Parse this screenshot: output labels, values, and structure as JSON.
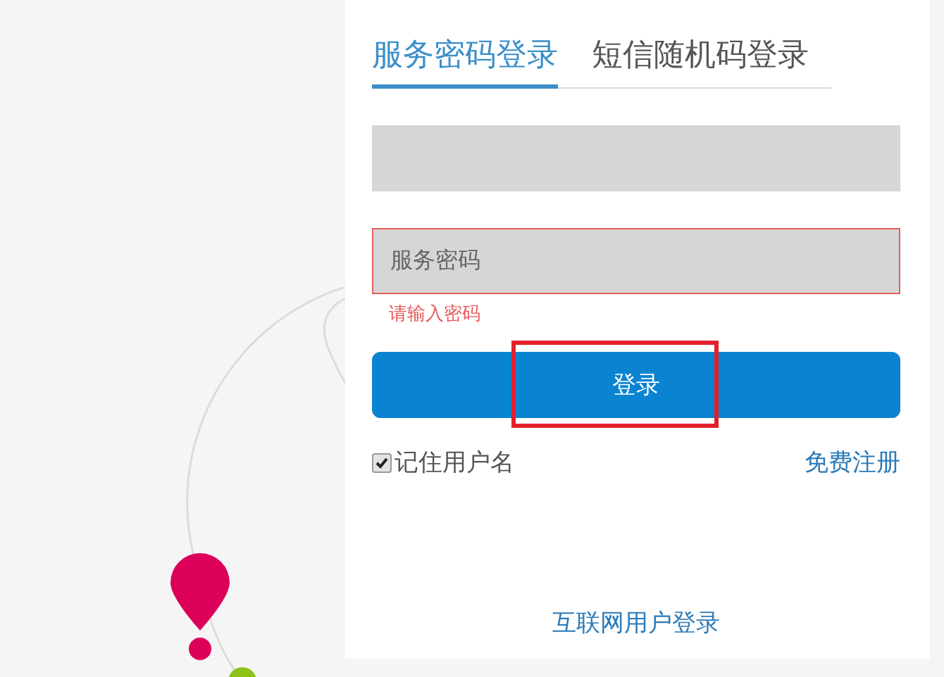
{
  "tabs": [
    {
      "label": "服务密码登录",
      "selected": true
    },
    {
      "label": "短信随机码登录",
      "selected": false
    }
  ],
  "fields": [
    {
      "invalid": false
    },
    {
      "placeholder": "服务密码",
      "invalid": true,
      "error": "请输入密码"
    }
  ],
  "login_button": "登录",
  "remember": {
    "label": "记住用户名",
    "checked": true
  },
  "register_link": "免费注册",
  "internet_login_link": "互联网用户登录"
}
